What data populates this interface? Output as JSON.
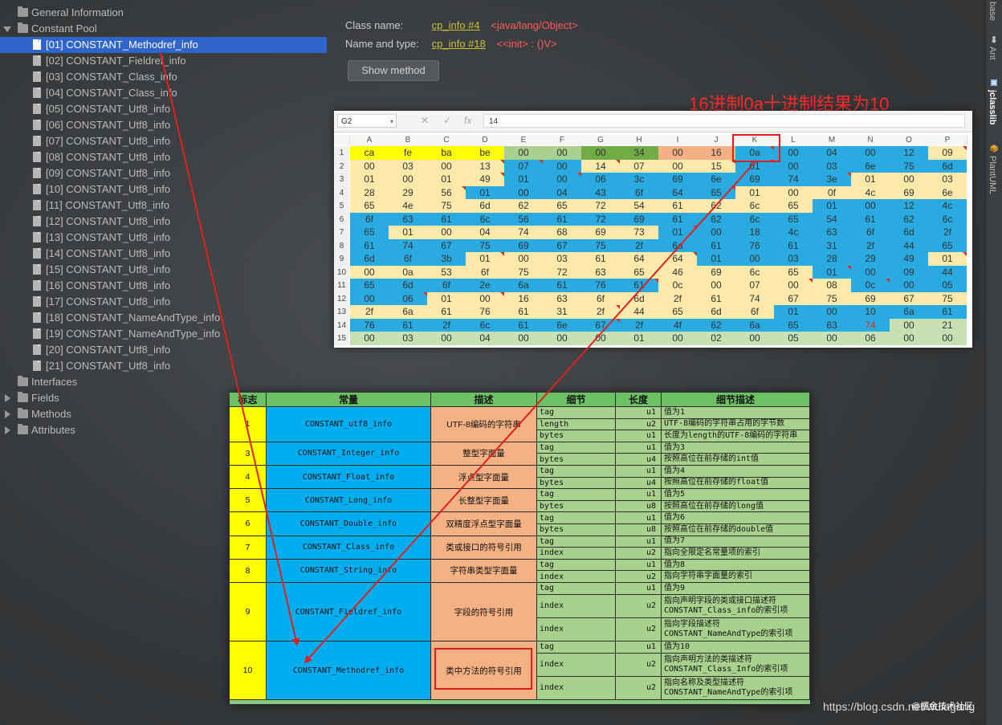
{
  "tree": {
    "general_information": "General Information",
    "constant_pool": "Constant Pool",
    "items": [
      "[01] CONSTANT_Methodref_info",
      "[02] CONSTANT_Fieldref_info",
      "[03] CONSTANT_Class_info",
      "[04] CONSTANT_Class_info",
      "[05] CONSTANT_Utf8_info",
      "[06] CONSTANT_Utf8_info",
      "[07] CONSTANT_Utf8_info",
      "[08] CONSTANT_Utf8_info",
      "[09] CONSTANT_Utf8_info",
      "[10] CONSTANT_Utf8_info",
      "[11] CONSTANT_Utf8_info",
      "[12] CONSTANT_Utf8_info",
      "[13] CONSTANT_Utf8_info",
      "[14] CONSTANT_Utf8_info",
      "[15] CONSTANT_Utf8_info",
      "[16] CONSTANT_Utf8_info",
      "[17] CONSTANT_Utf8_info",
      "[18] CONSTANT_NameAndType_info",
      "[19] CONSTANT_NameAndType_info",
      "[20] CONSTANT_Utf8_info",
      "[21] CONSTANT_Utf8_info"
    ],
    "selected_index": 0,
    "interfaces": "Interfaces",
    "fields": "Fields",
    "methods": "Methods",
    "attributes": "Attributes"
  },
  "info": {
    "class_name_label": "Class name:",
    "class_name_link": "cp_info #4",
    "class_name_value": "<java/lang/Object>",
    "name_type_label": "Name and type:",
    "name_type_link": "cp_info #18",
    "name_type_value": "<<init> : ()V>",
    "show_method_button": "Show method"
  },
  "right_strip": {
    "tabs": [
      "base",
      "Ant",
      "jclasslib",
      "PlantUML"
    ],
    "active_tab": "jclasslib"
  },
  "annotation": "16进制0a十进制结果为10",
  "spreadsheet": {
    "name_box": "G2",
    "formula_value": "14",
    "fx": "fx",
    "columns": [
      "A",
      "B",
      "C",
      "D",
      "E",
      "F",
      "G",
      "H",
      "I",
      "J",
      "K",
      "L",
      "M",
      "N",
      "O",
      "P"
    ],
    "rows": [
      [
        "ca",
        "fe",
        "ba",
        "be",
        "00",
        "00",
        "00",
        "34",
        "00",
        "16",
        "0a",
        "00",
        "04",
        "00",
        "12",
        "09"
      ],
      [
        "00",
        "03",
        "00",
        "13",
        "07",
        "00",
        "14",
        "07",
        "00",
        "15",
        "01",
        "00",
        "03",
        "6e",
        "75",
        "6d"
      ],
      [
        "01",
        "00",
        "01",
        "49",
        "01",
        "00",
        "06",
        "3c",
        "69",
        "6e",
        "69",
        "74",
        "3e",
        "01",
        "00",
        "03"
      ],
      [
        "28",
        "29",
        "56",
        "01",
        "00",
        "04",
        "43",
        "6f",
        "64",
        "65",
        "01",
        "00",
        "0f",
        "4c",
        "69",
        "6e"
      ],
      [
        "65",
        "4e",
        "75",
        "6d",
        "62",
        "65",
        "72",
        "54",
        "61",
        "62",
        "6c",
        "65",
        "01",
        "00",
        "12",
        "4c"
      ],
      [
        "6f",
        "63",
        "61",
        "6c",
        "56",
        "61",
        "72",
        "69",
        "61",
        "62",
        "6c",
        "65",
        "54",
        "61",
        "62",
        "6c"
      ],
      [
        "65",
        "01",
        "00",
        "04",
        "74",
        "68",
        "69",
        "73",
        "01",
        "00",
        "18",
        "4c",
        "63",
        "6f",
        "6d",
        "2f"
      ],
      [
        "61",
        "74",
        "67",
        "75",
        "69",
        "67",
        "75",
        "2f",
        "6a",
        "61",
        "76",
        "61",
        "31",
        "2f",
        "44",
        "65"
      ],
      [
        "6d",
        "6f",
        "3b",
        "01",
        "00",
        "03",
        "61",
        "64",
        "64",
        "01",
        "00",
        "03",
        "28",
        "29",
        "49",
        "01"
      ],
      [
        "00",
        "0a",
        "53",
        "6f",
        "75",
        "72",
        "63",
        "65",
        "46",
        "69",
        "6c",
        "65",
        "01",
        "00",
        "09",
        "44"
      ],
      [
        "65",
        "6d",
        "6f",
        "2e",
        "6a",
        "61",
        "76",
        "61",
        "0c",
        "00",
        "07",
        "00",
        "08",
        "0c",
        "00",
        "05"
      ],
      [
        "00",
        "06",
        "01",
        "00",
        "16",
        "63",
        "6f",
        "6d",
        "2f",
        "61",
        "74",
        "67",
        "75",
        "69",
        "67",
        "75"
      ],
      [
        "2f",
        "6a",
        "61",
        "76",
        "61",
        "31",
        "2f",
        "44",
        "65",
        "6d",
        "6f",
        "01",
        "00",
        "10",
        "6a",
        "61"
      ],
      [
        "76",
        "61",
        "2f",
        "6c",
        "61",
        "6e",
        "67",
        "2f",
        "4f",
        "62",
        "6a",
        "65",
        "63",
        "74",
        "00",
        "21"
      ],
      [
        "00",
        "03",
        "00",
        "04",
        "00",
        "00",
        "00",
        "01",
        "00",
        "02",
        "00",
        "05",
        "00",
        "06",
        "00",
        "00"
      ]
    ],
    "colors": {
      "yellow": "#ffff00",
      "light_yellow": "#fde9a9",
      "blue": "#29aae1",
      "green_light": "#a9d08e",
      "green_dark": "#70ad47",
      "orange": "#f4b084",
      "mint": "#c6e0b4"
    }
  },
  "table": {
    "headers": [
      "标志",
      "常量",
      "描述",
      "细节",
      "长度",
      "细节描述"
    ],
    "groups": [
      {
        "flag": "1",
        "name": "CONSTANT_utf8_info",
        "desc": "UTF-8编码的字符串",
        "rows": [
          {
            "detail": "tag",
            "len": "u1",
            "ddesc": [
              "值为1"
            ]
          },
          {
            "detail": "length",
            "len": "u2",
            "ddesc": [
              "UTF-8编码的字符串占用的字节数"
            ]
          },
          {
            "detail": "bytes",
            "len": "u1",
            "ddesc": [
              "长度为length的UTF-8编码的字符串"
            ]
          }
        ]
      },
      {
        "flag": "3",
        "name": "CONSTANT_Integer_info",
        "desc": "整型字面量",
        "rows": [
          {
            "detail": "tag",
            "len": "u1",
            "ddesc": [
              "值为3"
            ]
          },
          {
            "detail": "bytes",
            "len": "u4",
            "ddesc": [
              "按照高位在前存储的int值"
            ]
          }
        ]
      },
      {
        "flag": "4",
        "name": "CONSTANT_Float_info",
        "desc": "浮点型字面量",
        "rows": [
          {
            "detail": "tag",
            "len": "u1",
            "ddesc": [
              "值为4"
            ]
          },
          {
            "detail": "bytes",
            "len": "u4",
            "ddesc": [
              "按照高位在前存储的float值"
            ]
          }
        ]
      },
      {
        "flag": "5",
        "name": "CONSTANT_Long_info",
        "desc": "长整型字面量",
        "rows": [
          {
            "detail": "tag",
            "len": "u1",
            "ddesc": [
              "值为5"
            ]
          },
          {
            "detail": "bytes",
            "len": "u8",
            "ddesc": [
              "按照高位在前存储的long值"
            ]
          }
        ]
      },
      {
        "flag": "6",
        "name": "CONSTANT_Double_info",
        "desc": "双精度浮点型字面量",
        "rows": [
          {
            "detail": "tag",
            "len": "u1",
            "ddesc": [
              "值为6"
            ]
          },
          {
            "detail": "bytes",
            "len": "u8",
            "ddesc": [
              "按照高位在前存储的double值"
            ]
          }
        ]
      },
      {
        "flag": "7",
        "name": "CONSTANT_Class_info",
        "desc": "类或接口的符号引用",
        "rows": [
          {
            "detail": "tag",
            "len": "u1",
            "ddesc": [
              "值为7"
            ]
          },
          {
            "detail": "index",
            "len": "u2",
            "ddesc": [
              "指向全限定名常量项的索引"
            ]
          }
        ]
      },
      {
        "flag": "8",
        "name": "CONSTANT_String_info",
        "desc": "字符串类型字面量",
        "rows": [
          {
            "detail": "tag",
            "len": "u1",
            "ddesc": [
              "值为8"
            ]
          },
          {
            "detail": "index",
            "len": "u2",
            "ddesc": [
              "指向字符串字面量的索引"
            ]
          }
        ]
      },
      {
        "flag": "9",
        "name": "CONSTANT_Fieldref_info",
        "desc": "字段的符号引用",
        "rows": [
          {
            "detail": "tag",
            "len": "u1",
            "ddesc": [
              "值为9"
            ]
          },
          {
            "detail": "index",
            "len": "u2",
            "ddesc": [
              "指向声明字段的类或接口描述符",
              "CONSTANT_Class_info的索引项"
            ]
          },
          {
            "detail": "index",
            "len": "u2",
            "ddesc": [
              "指向字段描述符",
              "CONSTANT_NameAndType的索引项"
            ]
          }
        ]
      },
      {
        "flag": "10",
        "name": "CONSTANT_Methodref_info",
        "desc": "类中方法的符号引用",
        "rows": [
          {
            "detail": "tag",
            "len": "u1",
            "ddesc": [
              "值为10"
            ]
          },
          {
            "detail": "index",
            "len": "u2",
            "ddesc": [
              "指向声明方法的类描述符",
              "CONSTANT_Class_Info的索引项"
            ]
          },
          {
            "detail": "index",
            "len": "u2",
            "ddesc": [
              "指向名称及类型描述符",
              "CONSTANT_NameAndType的索引项"
            ]
          }
        ]
      }
    ]
  },
  "watermark": "https://blog.csdn.net/wulagang",
  "watermark_badge": "@掘金技术社区"
}
